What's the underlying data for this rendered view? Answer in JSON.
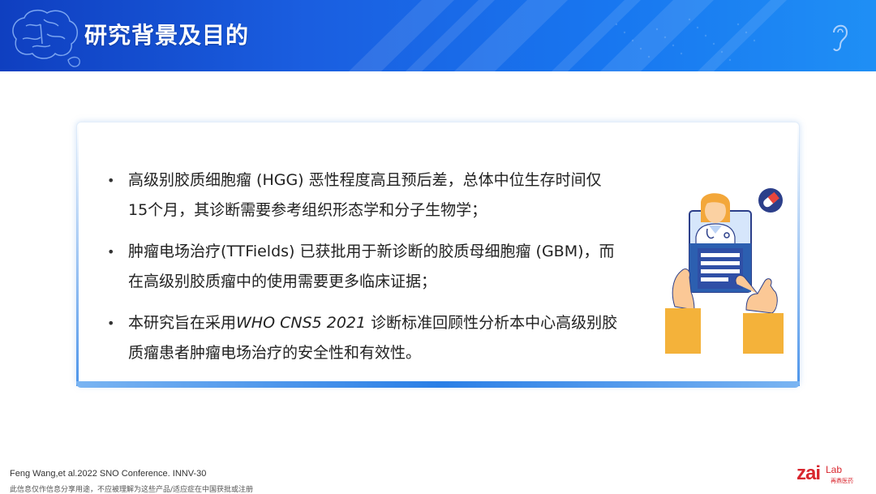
{
  "header": {
    "title": "研究背景及目的"
  },
  "bullets": [
    {
      "lines": [
        "高级别胶质细胞瘤 (HGG) 恶性程度高且预后差，总体中位生存时间仅",
        "15个月，其诊断需要参考组织形态学和分子生物学；"
      ]
    },
    {
      "lines": [
        "肿瘤电场治疗(TTFields) 已获批用于新诊断的胶质母细胞瘤 (GBM)，而",
        "在高级别胶质瘤中的使用需要更多临床证据；"
      ]
    },
    {
      "prefix": "本研究旨在采用",
      "italic": "WHO CNS5 2021",
      "suffix": " 诊断标准回顾性分析本中心高级别胶",
      "line2": "质瘤患者肿瘤电场治疗的安全性和有效性。"
    }
  ],
  "bullet_symbol": "•",
  "footer": {
    "citation": "Feng Wang,et al.2022 SNO Conference. INNV-30",
    "disclaimer": "此信息仅作信息分享用途，不应被理解为这些产品/适应症在中国获批或注册",
    "logo_main": "zai",
    "logo_lab": "Lab",
    "logo_cn": "再鼎医药"
  },
  "colors": {
    "header_blue": "#1a5ee0",
    "accent_red": "#d9262e",
    "pill_red": "#e8453c"
  }
}
